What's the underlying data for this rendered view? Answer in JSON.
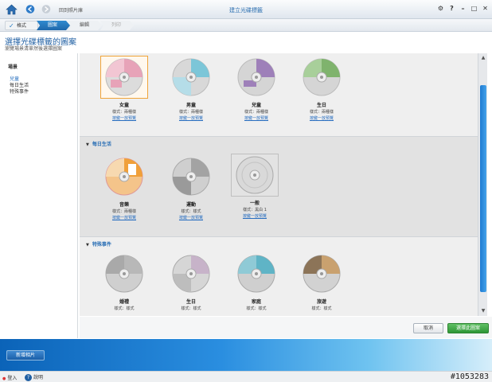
{
  "titlebar": {
    "back_label": "回到照片庫",
    "title": "建立光碟標籤",
    "controls": {
      "gear": "⚙",
      "help": "?",
      "minimize": "–",
      "maximize": "□",
      "close": "✕"
    }
  },
  "steps": [
    {
      "label": "格式",
      "state": "done"
    },
    {
      "label": "圖案",
      "state": "current"
    },
    {
      "label": "編輯",
      "state": "pending"
    },
    {
      "label": "列印",
      "state": "disabled"
    }
  ],
  "header": {
    "title": "選擇光碟標籤的圖案",
    "subtitle": "瀏覽場景清單然後選擇圖案"
  },
  "sidebar": {
    "heading": "場景",
    "items": [
      {
        "label": "兒童",
        "active": true
      },
      {
        "label": "每日生活",
        "active": false
      },
      {
        "label": "特殊事件",
        "active": false
      }
    ]
  },
  "gallery": {
    "sections": [
      {
        "title": "",
        "items": [
          {
            "name": "女童",
            "style": "樣式：兩種樣",
            "preview": "按鍵一放預覽"
          },
          {
            "name": "男童",
            "style": "樣式：兩種樣",
            "preview": "按鍵一放預覽"
          },
          {
            "name": "兒童",
            "style": "樣式：兩種樣",
            "preview": "按鍵一放預覽"
          },
          {
            "name": "生日",
            "style": "樣式：兩種樣",
            "preview": "按鍵一放預覽"
          }
        ]
      },
      {
        "title": "每日生活",
        "items": [
          {
            "name": "音樂",
            "style": "樣式：兩種樣",
            "preview": "按鍵一放預覽"
          },
          {
            "name": "運動",
            "style": "樣式：樣式",
            "preview": "按鍵一放預覽"
          },
          {
            "name": "一般",
            "style": "樣式：黑白 1",
            "preview": "按鍵一放預覽"
          }
        ]
      },
      {
        "title": "特殊事件",
        "items": [
          {
            "name": "婚禮",
            "style": "樣式：樣式",
            "preview": ""
          },
          {
            "name": "生日",
            "style": "樣式：樣式",
            "preview": ""
          },
          {
            "name": "家庭",
            "style": "樣式：樣式",
            "preview": ""
          },
          {
            "name": "旅遊",
            "style": "樣式：樣式",
            "preview": ""
          }
        ]
      }
    ]
  },
  "footer": {
    "cancel": "取消",
    "choose": "選擇此圖案"
  },
  "tray": {
    "add_photos": "新增相片"
  },
  "status": {
    "login": "登入",
    "help": "說明",
    "code": "#1053283"
  },
  "colors": {
    "accent": "#2a72c0",
    "selected_border": "#f0a43a",
    "choose_button": "#3aa141",
    "scroll_thumb": "#2a8ee0",
    "disc_pink": "#e7a3b8",
    "disc_teal": "#7cc6d8",
    "disc_purple": "#9e80b9",
    "disc_green": "#7fb36d",
    "disc_orange": "#f0a03a",
    "disc_gray": "#a3a3a3",
    "disc_cyan": "#5fb4c6",
    "disc_beige": "#c9a16f"
  }
}
